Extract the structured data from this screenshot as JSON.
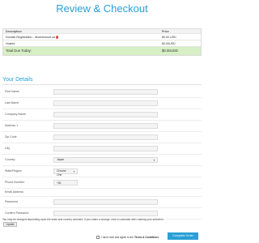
{
  "page": {
    "title": "Review & Checkout"
  },
  "summary": {
    "headers": [
      "Description",
      "Price"
    ],
    "items": [
      {
        "description": "Domain Registration - devcheckout.ca",
        "price": "$0.00 USD"
      },
      {
        "description": "Hosted",
        "price": "$0.00USD"
      }
    ],
    "total_label": "Total Due Today:",
    "total_value": "$0.00USD"
  },
  "details": {
    "title": "Your Details",
    "fields": [
      {
        "label": "First Name",
        "value": ""
      },
      {
        "label": "Last Name",
        "value": ""
      },
      {
        "label": "Company Name",
        "value": ""
      },
      {
        "label": "Address 1",
        "value": ""
      },
      {
        "label": "Zip Code",
        "value": ""
      },
      {
        "label": "City",
        "value": ""
      },
      {
        "label": "Country",
        "value": "Japan"
      },
      {
        "label": "State/Region",
        "value": "Choose One"
      },
      {
        "label": "Phone Number",
        "value": "+81"
      },
      {
        "label": "Email Address",
        "value": ""
      },
      {
        "label": "Password",
        "value": ""
      },
      {
        "label": "Confirm Password",
        "value": ""
      }
    ]
  },
  "note": {
    "text": "Tax may be charged depending upon the state and country selected. If you make a change, click to calculate after making your selection.",
    "update_label": "Update"
  },
  "agreement": {
    "text": "I have read and agree to the",
    "link": "Terms & Conditions"
  },
  "checkout": {
    "button_label": "Complete Order"
  },
  "colors": {
    "accent": "#2a9fd6",
    "total_bg": "#d6efc4",
    "remove": "#d9534f"
  }
}
